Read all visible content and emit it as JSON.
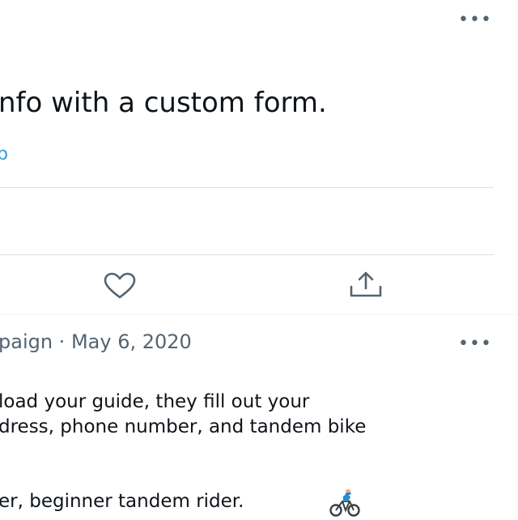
{
  "tweet_top": {
    "more_icon": "more-horizontal-icon",
    "title_fragment": "nfo with a custom form.",
    "link_fragment": "p",
    "actions": {
      "like_icon": "heart-icon",
      "share_icon": "share-upload-icon"
    }
  },
  "tweet_reply": {
    "meta": "paign · May 6, 2020",
    "more_icon": "more-horizontal-icon",
    "lines": [
      "load your guide, they fill out your",
      "dress, phone number, and tandem bike",
      "er, beginner tandem rider."
    ],
    "emoji_icon": "cyclist-emoji-icon"
  },
  "colors": {
    "text": "#0f1419",
    "secondary": "#536471",
    "link": "#1d9bf0",
    "divider": "#dbe1e6"
  }
}
